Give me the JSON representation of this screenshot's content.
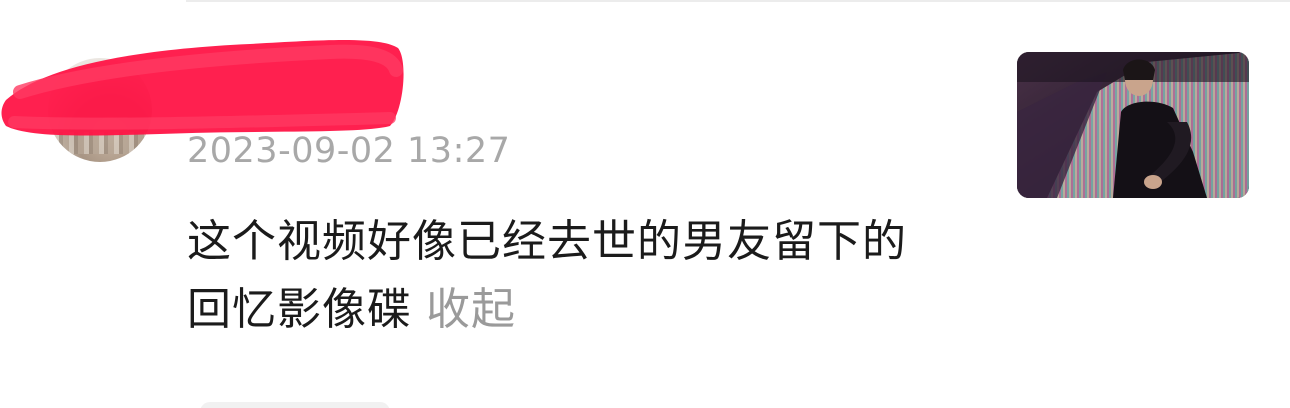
{
  "comment": {
    "timestamp": "2023-09-02 13:27",
    "text": "这个视频好像已经去世的男友留下的回忆影像碟",
    "collapse_label": "收起"
  },
  "thumbnail": {
    "icon": "video-thumbnail"
  },
  "colors": {
    "redaction": "#ff1446",
    "timestamp": "#a8a8a8",
    "text": "#1b1b1b",
    "collapse": "#9a9a9a"
  }
}
